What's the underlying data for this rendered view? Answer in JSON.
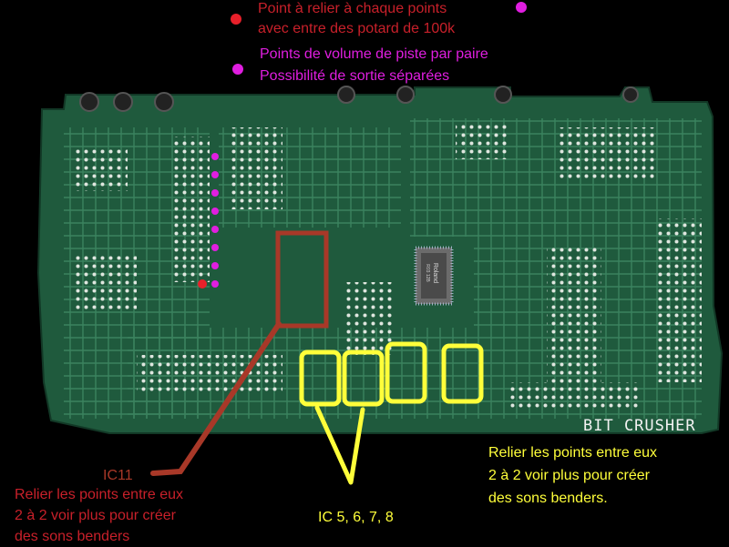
{
  "colors": {
    "background": "#000000",
    "pcb": "#1f5a3d",
    "trace": "#3a8360",
    "trace_light": "#5aa37b",
    "pad": "#e8eee8",
    "red_marker": "#e8202a",
    "magenta_marker": "#e01ee0",
    "red_annotation": "#c8202a",
    "brown_annotation": "#a83828",
    "yellow_annotation": "#ffff3a",
    "white_text": "#f2f2f2"
  },
  "legend": {
    "red_lines": [
      "Point à relier à chaque points",
      "avec entre des potard de 100k"
    ],
    "magenta_lines": [
      "Points de volume de piste par paire",
      "Possibilité de sortie séparées"
    ]
  },
  "board": {
    "chip_label": [
      "Roland",
      "R03 12B"
    ]
  },
  "brand": "BIT CRUSHER",
  "annotations": {
    "right_yellow": [
      "Relier les points entre eux",
      "2 à 2 voir plus pour créer",
      "des sons benders."
    ],
    "ic11_label": "IC11",
    "left_red": [
      "Relier les points entre eux",
      "2 à 2 voir plus pour créer",
      "des sons benders"
    ],
    "ic_group_label": "IC 5, 6, 7, 8"
  }
}
